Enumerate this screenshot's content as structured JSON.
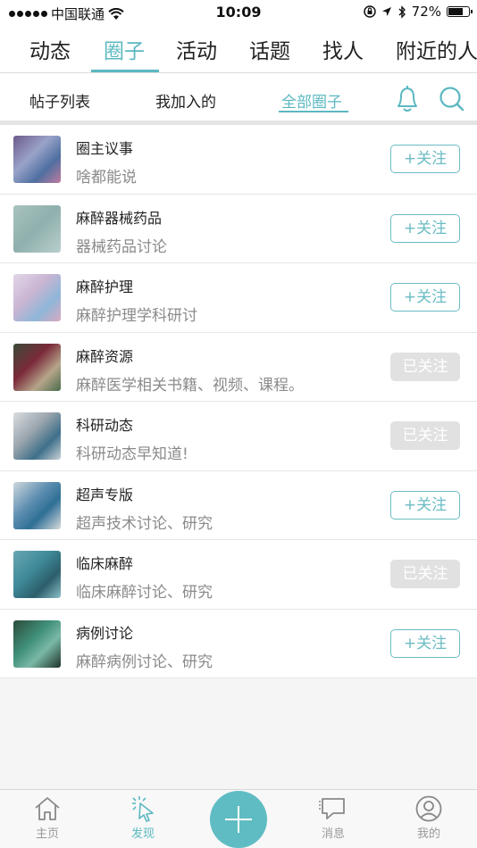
{
  "status_bar": {
    "carrier": "中国联通",
    "time": "10:09",
    "battery": "72%",
    "battery_level": 0.72,
    "icons": [
      "signal-dots-icon",
      "wifi-icon",
      "orientation-lock-icon",
      "location-arrow-icon",
      "bluetooth-icon",
      "battery-icon"
    ]
  },
  "top_tabs": [
    {
      "label": "动态",
      "active": false
    },
    {
      "label": "圈子",
      "active": true
    },
    {
      "label": "活动",
      "active": false
    },
    {
      "label": "话题",
      "active": false
    },
    {
      "label": "找人",
      "active": false
    },
    {
      "label": "附近的人",
      "active": false
    }
  ],
  "sub_tabs": [
    {
      "label": "帖子列表",
      "active": false
    },
    {
      "label": "我加入的",
      "active": false
    },
    {
      "label": "全部圈子",
      "active": true
    }
  ],
  "colors": {
    "accent": "#5bb8c1",
    "followed_bg": "#e1e1e1",
    "desc_text": "#8a8a8a"
  },
  "circles": [
    {
      "title": "圈主议事",
      "desc": "啥都能说",
      "button": "+关注",
      "followed": false
    },
    {
      "title": "麻醉器械药品",
      "desc": "器械药品讨论",
      "button": "+关注",
      "followed": false
    },
    {
      "title": "麻醉护理",
      "desc": "麻醉护理学科研讨",
      "button": "+关注",
      "followed": false
    },
    {
      "title": "麻醉资源",
      "desc": "麻醉医学相关书籍、视频、课程。",
      "button": "已关注",
      "followed": true
    },
    {
      "title": "科研动态",
      "desc": "科研动态早知道!",
      "button": "已关注",
      "followed": true
    },
    {
      "title": "超声专版",
      "desc": "超声技术讨论、研究",
      "button": "+关注",
      "followed": false
    },
    {
      "title": "临床麻醉",
      "desc": "临床麻醉讨论、研究",
      "button": "已关注",
      "followed": true
    },
    {
      "title": "病例讨论",
      "desc": "麻醉病例讨论、研究",
      "button": "+关注",
      "followed": false
    }
  ],
  "bottom_nav": [
    {
      "label": "主页",
      "icon": "home-icon",
      "active": false
    },
    {
      "label": "发现",
      "icon": "discover-icon",
      "active": true
    },
    {
      "label": "",
      "icon": "plus-icon",
      "active": false
    },
    {
      "label": "消息",
      "icon": "message-icon",
      "active": false
    },
    {
      "label": "我的",
      "icon": "profile-icon",
      "active": false
    }
  ]
}
